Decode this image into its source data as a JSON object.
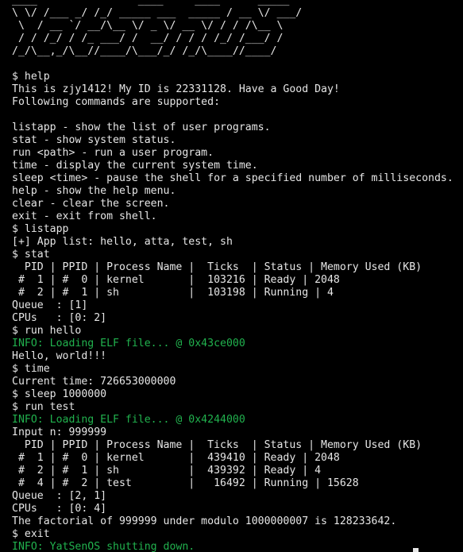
{
  "terminal": {
    "colors": {
      "background": "#000000",
      "text": "#e6e6e6",
      "info": "#21b24e"
    },
    "lines": [
      {
        "text": "____                ____     ____      _____ ",
        "kind": "normal"
      },
      {
        "text": "\\ \\/ /___ _/ /_/ _____ ___  _____ / __ \\/ ___/",
        "kind": "normal"
      },
      {
        "text": " \\  / __ `/ __/\\__ \\/ _ \\/ __ \\/ / / /\\__ \\ ",
        "kind": "normal"
      },
      {
        "text": " / / /_/ / /_ ___/ /  __/ / / / /_/ /___/ / ",
        "kind": "normal"
      },
      {
        "text": "/_/\\__,_/\\__//____/\\___/_/ /_/\\____//____/  ",
        "kind": "normal"
      },
      {
        "text": "",
        "kind": "normal"
      },
      {
        "text": "$ help",
        "kind": "normal"
      },
      {
        "text": "This is zjy1412! My ID is 22331128. Have a Good Day!",
        "kind": "normal"
      },
      {
        "text": "Following commands are supported:",
        "kind": "normal"
      },
      {
        "text": "",
        "kind": "normal"
      },
      {
        "text": "listapp - show the list of user programs.",
        "kind": "normal"
      },
      {
        "text": "stat - show system status.",
        "kind": "normal"
      },
      {
        "text": "run <path> - run a user program.",
        "kind": "normal"
      },
      {
        "text": "time - display the current system time.",
        "kind": "normal"
      },
      {
        "text": "sleep <time> - pause the shell for a specified number of milliseconds.",
        "kind": "normal"
      },
      {
        "text": "help - show the help menu.",
        "kind": "normal"
      },
      {
        "text": "clear - clear the screen.",
        "kind": "normal"
      },
      {
        "text": "exit - exit from shell.",
        "kind": "normal"
      },
      {
        "text": "$ listapp",
        "kind": "normal"
      },
      {
        "text": "[+] App list: hello, atta, test, sh",
        "kind": "normal"
      },
      {
        "text": "$ stat",
        "kind": "normal"
      },
      {
        "text": "  PID | PPID | Process Name |  Ticks  | Status | Memory Used (KB)",
        "kind": "normal"
      },
      {
        "text": " #  1 | #  0 | kernel       |  103216 | Ready | 2048",
        "kind": "normal"
      },
      {
        "text": " #  2 | #  1 | sh           |  103198 | Running | 4",
        "kind": "normal"
      },
      {
        "text": "Queue  : [1]",
        "kind": "normal"
      },
      {
        "text": "CPUs   : [0: 2]",
        "kind": "normal"
      },
      {
        "text": "$ run hello",
        "kind": "normal"
      },
      {
        "text": "INFO: Loading ELF file... @ 0x43ce000",
        "kind": "info"
      },
      {
        "text": "Hello, world!!!",
        "kind": "normal"
      },
      {
        "text": "$ time",
        "kind": "normal"
      },
      {
        "text": "Current time: 726653000000",
        "kind": "normal"
      },
      {
        "text": "$ sleep 1000000",
        "kind": "normal"
      },
      {
        "text": "$ run test",
        "kind": "normal"
      },
      {
        "text": "INFO: Loading ELF file... @ 0x4244000",
        "kind": "info"
      },
      {
        "text": "Input n: 999999",
        "kind": "normal"
      },
      {
        "text": "  PID | PPID | Process Name |  Ticks  | Status | Memory Used (KB)",
        "kind": "normal"
      },
      {
        "text": " #  1 | #  0 | kernel       |  439410 | Ready | 2048",
        "kind": "normal"
      },
      {
        "text": " #  2 | #  1 | sh           |  439392 | Ready | 4",
        "kind": "normal"
      },
      {
        "text": " #  4 | #  2 | test         |   16492 | Running | 15628",
        "kind": "normal"
      },
      {
        "text": "Queue  : [2, 1]",
        "kind": "normal"
      },
      {
        "text": "CPUs   : [0: 4]",
        "kind": "normal"
      },
      {
        "text": "The factorial of 999999 under modulo 1000000007 is 128233642.",
        "kind": "normal"
      },
      {
        "text": "$ exit",
        "kind": "normal"
      },
      {
        "text": "INFO: YatSenOS shutting down.",
        "kind": "info"
      }
    ]
  }
}
